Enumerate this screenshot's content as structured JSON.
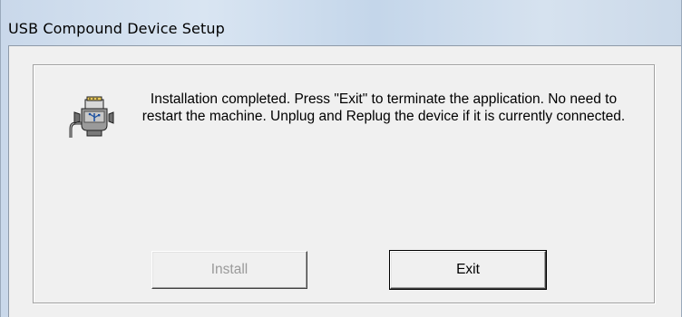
{
  "window": {
    "title": "USB Compound Device Setup"
  },
  "dialog": {
    "message": "Installation completed. Press \"Exit\" to terminate the application. No need to restart the machine. Unplug and Replug the device if it is currently connected.",
    "icon": "usb-device-icon"
  },
  "buttons": {
    "install_label": "Install",
    "install_enabled": false,
    "exit_label": "Exit",
    "exit_default": true
  }
}
